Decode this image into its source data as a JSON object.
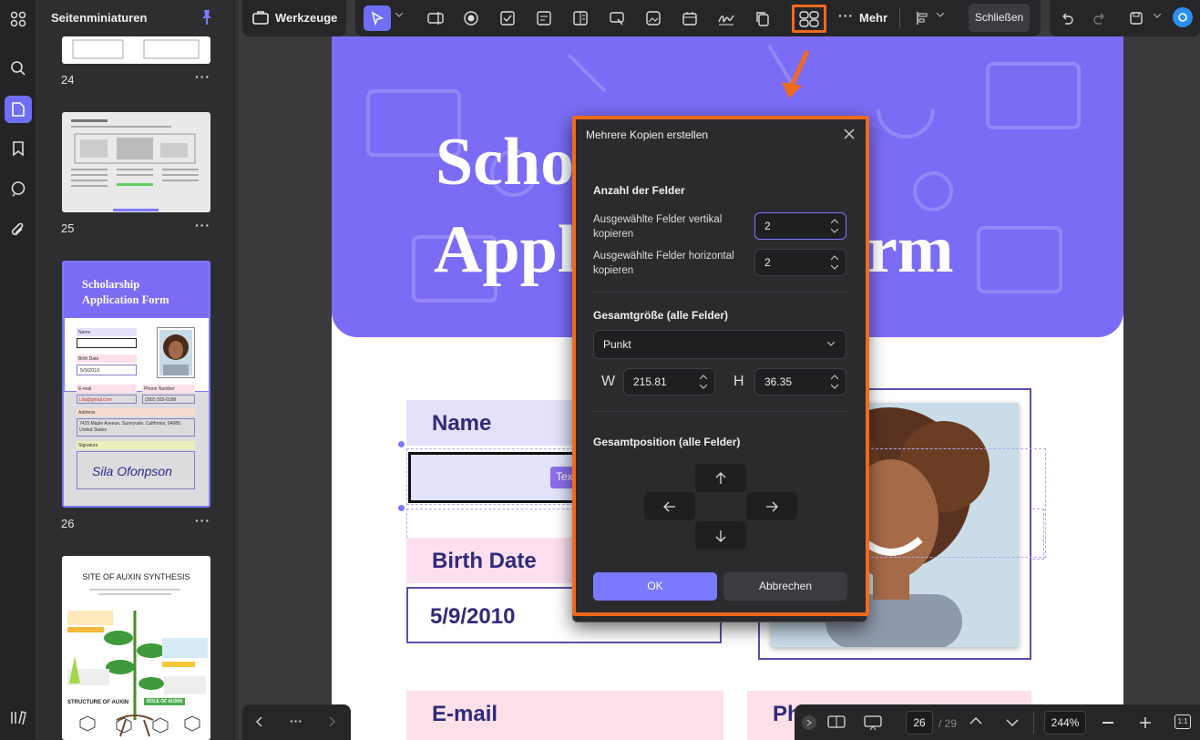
{
  "panel": {
    "title": "Seitenminiaturen"
  },
  "thumbnails": [
    {
      "page": "24"
    },
    {
      "page": "25"
    },
    {
      "page": "26",
      "title": "Scholarship Application Form",
      "name_label": "Name",
      "birth_label": "Birth Date",
      "birth_value": "5/9/2010",
      "email_label": "E-mail",
      "email_value": "Lila@gmail.com",
      "phone_label": "Phone Number",
      "phone_value": "(282) 555-0198",
      "address_label": "Address",
      "address_value": "7425 Maple Avenue, Sunnyvale, California, 94086, United States",
      "signature_label": "Signature",
      "signature_value": "Sila Ofonpson"
    },
    {
      "page": "",
      "title": "SITE OF AUXIN SYNTHESIS",
      "footer_left": "STRUCTURE OF AUXIN",
      "footer_right": "ROLE OF AUXIN"
    }
  ],
  "toolbar": {
    "tools_label": "Werkzeuge",
    "more_label": "Mehr",
    "close_label": "Schließen"
  },
  "document": {
    "title_line1": "Scho",
    "title_line1_end": "",
    "title_line2_start": "Appl",
    "title_line2_end": "rm",
    "name_label": "Name",
    "field_tag": "Tex",
    "birth_label": "Birth Date",
    "birth_value": "5/9/2010",
    "email_label": "E-mail",
    "phone_label_partial": "Ph"
  },
  "dialog": {
    "title": "Mehrere Kopien erstellen",
    "section_count": "Anzahl der Felder",
    "vertical_label": "Ausgewählte Felder vertikal kopieren",
    "vertical_value": "2",
    "horizontal_label": "Ausgewählte Felder horizontal kopieren",
    "horizontal_value": "2",
    "section_size": "Gesamtgröße (alle Felder)",
    "unit_value": "Punkt",
    "w_label": "W",
    "w_value": "215.81",
    "h_label": "H",
    "h_value": "36.35",
    "section_position": "Gesamtposition (alle Felder)",
    "ok_label": "OK",
    "cancel_label": "Abbrechen"
  },
  "bottombar": {
    "page_current": "26",
    "page_total": "/ 29",
    "zoom": "244%",
    "fit_label": "1:1"
  },
  "colors": {
    "accent": "#6f6ef4",
    "highlight": "#f06a1e",
    "banner": "#7b6cf6"
  }
}
